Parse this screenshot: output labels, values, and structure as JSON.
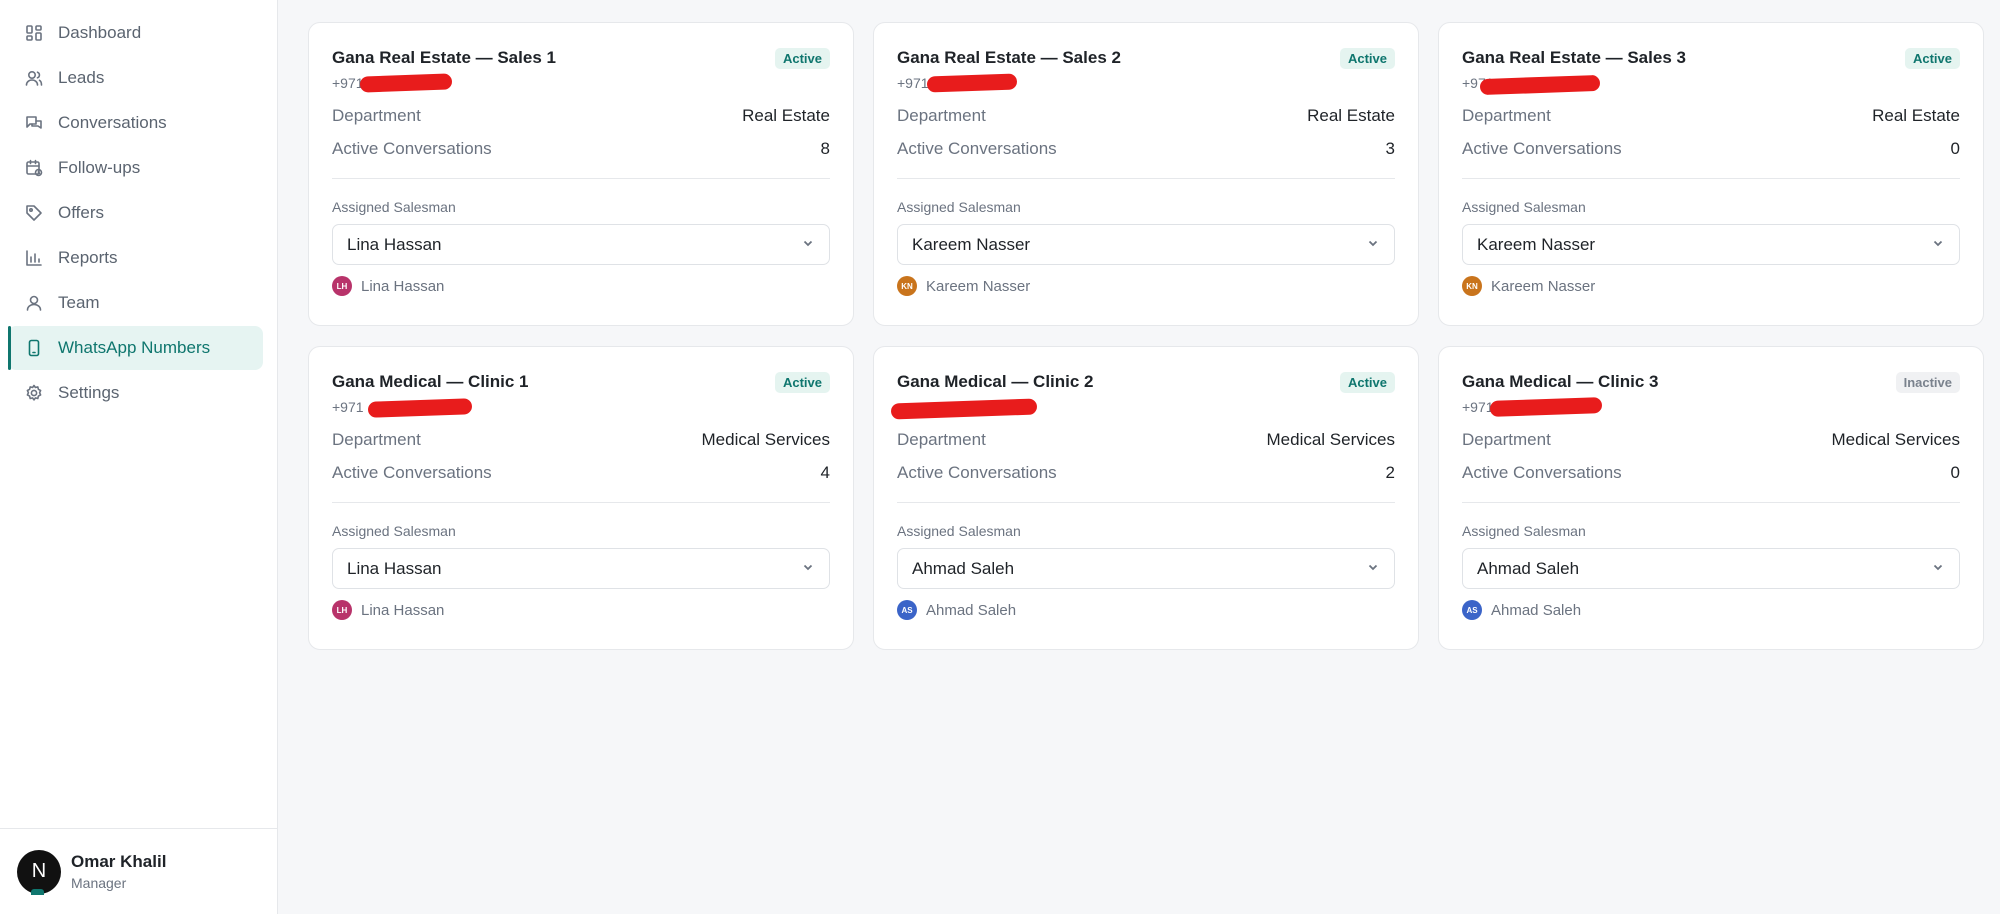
{
  "sidebar": {
    "items": [
      {
        "label": "Dashboard",
        "icon": "dashboard-icon"
      },
      {
        "label": "Leads",
        "icon": "users-icon"
      },
      {
        "label": "Conversations",
        "icon": "chat-icon"
      },
      {
        "label": "Follow-ups",
        "icon": "calendar-clock-icon"
      },
      {
        "label": "Offers",
        "icon": "tag-icon"
      },
      {
        "label": "Reports",
        "icon": "bar-chart-icon"
      },
      {
        "label": "Team",
        "icon": "user-icon"
      },
      {
        "label": "WhatsApp Numbers",
        "icon": "phone-icon"
      },
      {
        "label": "Settings",
        "icon": "gear-icon"
      }
    ],
    "active_index": 7,
    "user": {
      "initial": "N",
      "name": "Omar Khalil",
      "role": "Manager"
    }
  },
  "labels": {
    "department": "Department",
    "active_conversations": "Active Conversations",
    "assigned_salesman": "Assigned Salesman"
  },
  "cards": [
    {
      "title": "Gana Real Estate — Sales 1",
      "status": "Active",
      "phone": "+971",
      "department": "Real Estate",
      "active_conversations": "8",
      "salesman": "Lina Hassan",
      "initials": "LH",
      "avatar_color": "#b8336a"
    },
    {
      "title": "Gana Real Estate — Sales 2",
      "status": "Active",
      "phone": "+971",
      "department": "Real Estate",
      "active_conversations": "3",
      "salesman": "Kareem Nasser",
      "initials": "KN",
      "avatar_color": "#c9741c"
    },
    {
      "title": "Gana Real Estate — Sales 3",
      "status": "Active",
      "phone": "+971",
      "department": "Real Estate",
      "active_conversations": "0",
      "salesman": "Kareem Nasser",
      "initials": "KN",
      "avatar_color": "#c9741c"
    },
    {
      "title": "Gana Medical — Clinic 1",
      "status": "Active",
      "phone": "+971",
      "department": "Medical Services",
      "active_conversations": "4",
      "salesman": "Lina Hassan",
      "initials": "LH",
      "avatar_color": "#b8336a"
    },
    {
      "title": "Gana Medical — Clinic 2",
      "status": "Active",
      "phone": "",
      "department": "Medical Services",
      "active_conversations": "2",
      "salesman": "Ahmad Saleh",
      "initials": "AS",
      "avatar_color": "#3b64c8"
    },
    {
      "title": "Gana Medical — Clinic 3",
      "status": "Inactive",
      "phone": "+971",
      "department": "Medical Services",
      "active_conversations": "0",
      "salesman": "Ahmad Saleh",
      "initials": "AS",
      "avatar_color": "#3b64c8"
    }
  ],
  "colors": {
    "accent": "#0f766e",
    "redaction": "#e81c1c"
  }
}
